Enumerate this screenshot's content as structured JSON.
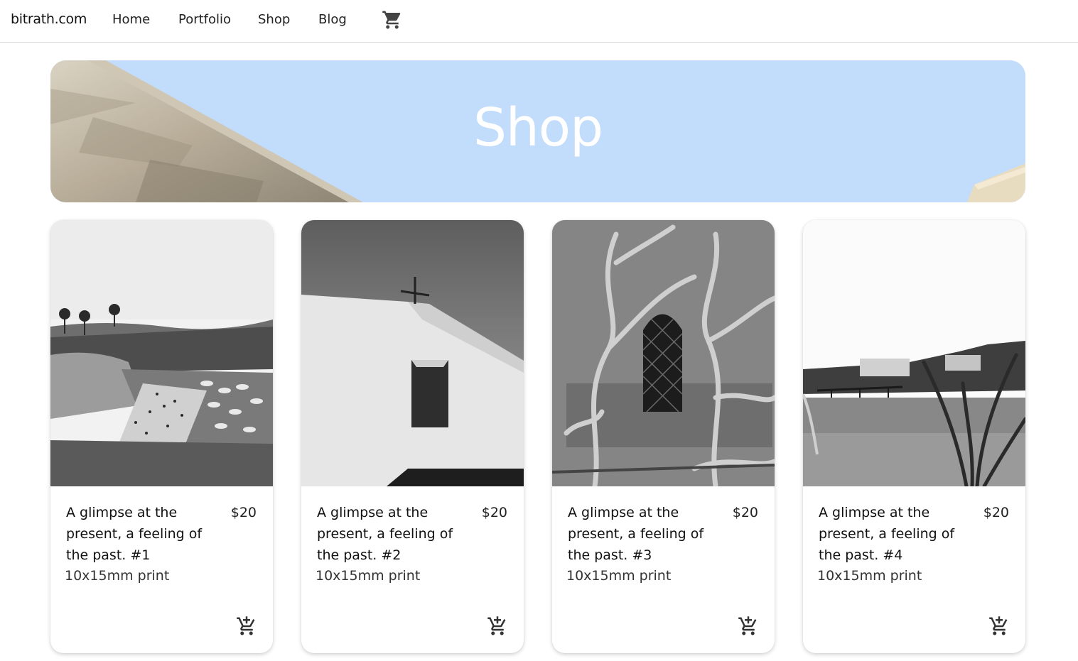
{
  "nav": {
    "brand": "bitrath.com",
    "links": [
      "Home",
      "Portfolio",
      "Shop",
      "Blog"
    ],
    "cart_icon": "shopping-cart-icon"
  },
  "hero": {
    "title": "Shop",
    "sky_color": "#c2dcfb"
  },
  "products": [
    {
      "title": "A glimpse at the present, a feeling of the past. #1",
      "price": "$20",
      "subtitle": "10x15mm print",
      "image": "beach-photo",
      "add_icon": "add-to-cart-icon"
    },
    {
      "title": "A glimpse at the present, a feeling of the past. #2",
      "price": "$20",
      "subtitle": "10x15mm print",
      "image": "chapel-photo",
      "add_icon": "add-to-cart-icon"
    },
    {
      "title": "A glimpse at the present, a feeling of the past. #3",
      "price": "$20",
      "subtitle": "10x15mm print",
      "image": "vine-window-photo",
      "add_icon": "add-to-cart-icon"
    },
    {
      "title": "A glimpse at the present, a feeling of the past. #4",
      "price": "$20",
      "subtitle": "10x15mm print",
      "image": "bay-photo",
      "add_icon": "add-to-cart-icon"
    }
  ]
}
